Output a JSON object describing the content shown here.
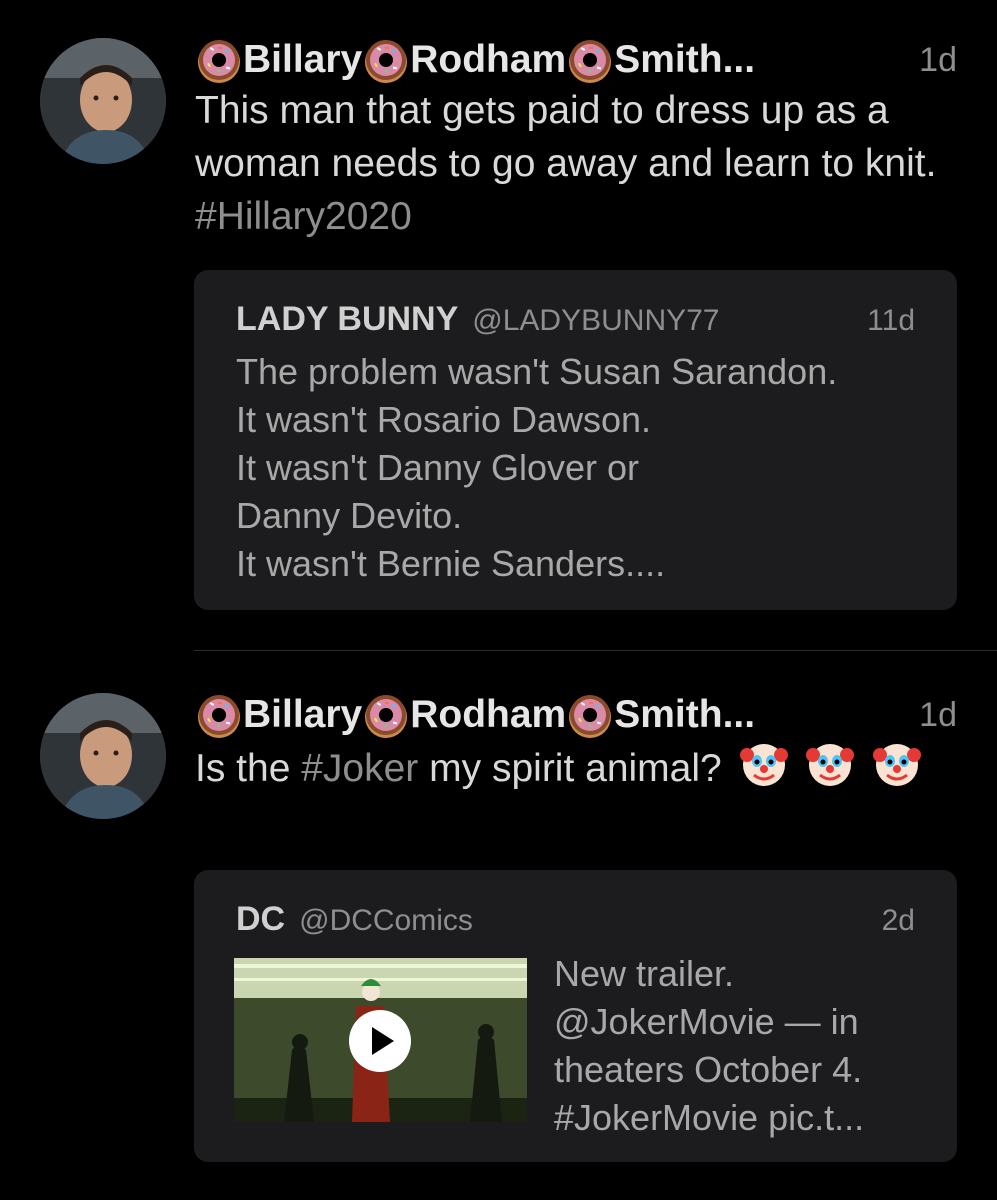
{
  "tweets": [
    {
      "author_name": "Billary",
      "author_name_2": "Rodham",
      "author_name_3": "Smith...",
      "time": "1d",
      "text_main": "This man that gets paid to dress up as a woman needs to go away and learn to knit.",
      "hashtag": "#Hillary2020",
      "quote": {
        "name": "LADY BUNNY",
        "handle": "@LADYBUNNY77",
        "time": "11d",
        "lines": [
          "The problem wasn't Susan Sarandon.",
          "It wasn't Rosario Dawson.",
          "It wasn't Danny Glover or",
          "Danny Devito.",
          "It wasn't Bernie Sanders...."
        ]
      }
    },
    {
      "author_name": "Billary",
      "author_name_2": "Rodham",
      "author_name_3": "Smith...",
      "time": "1d",
      "text_prefix": "Is the",
      "hashtag": "#Joker",
      "text_suffix": "my spirit animal?",
      "quote": {
        "name": "DC",
        "handle": "@DCComics",
        "time": "2d",
        "lines": [
          "New trailer.",
          "@JokerMovie — in",
          "theaters October 4.",
          "#JokerMovie pic.t..."
        ]
      }
    }
  ],
  "icons": {
    "name_separator": "donut-emoji",
    "reaction": "clown-face-emoji",
    "media_play": "play-icon"
  }
}
